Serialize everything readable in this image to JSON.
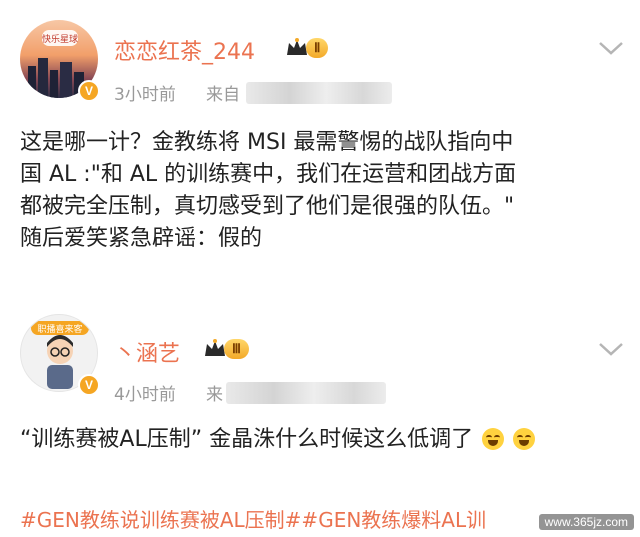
{
  "posts": [
    {
      "username": "恋恋红茶_244",
      "level": "Ⅱ",
      "time": "3小时前",
      "source_prefix": "来自",
      "verified": "V",
      "content_lines": [
        "这是哪一计？金教练将 MSI 最需警惕的战队指向中",
        "国 AL :\"和 AL 的训练赛中，我们在运营和团战方面",
        "都被完全压制，真切感受到了他们是很强的队伍。\"",
        "随后爱笑紧急辟谣：假的"
      ]
    },
    {
      "username": "丶涵艺",
      "level": "Ⅲ",
      "time": "4小时前",
      "source_prefix": "来",
      "verified": "V",
      "content_lines": [
        "“训练赛被AL压制” 金晶洙什么时候这么低调了"
      ]
    }
  ],
  "hashtags": "#GEN教练说训练赛被AL压制##GEN教练爆料AL训",
  "watermark": "www.365jz.com",
  "colors": {
    "username": "#eb7350",
    "meta": "#999999",
    "badge_gold": "#f3a929"
  },
  "icons": [
    "crown-icon",
    "chevron-down-icon",
    "verified-icon",
    "laugh-cry-emoji-icon"
  ]
}
